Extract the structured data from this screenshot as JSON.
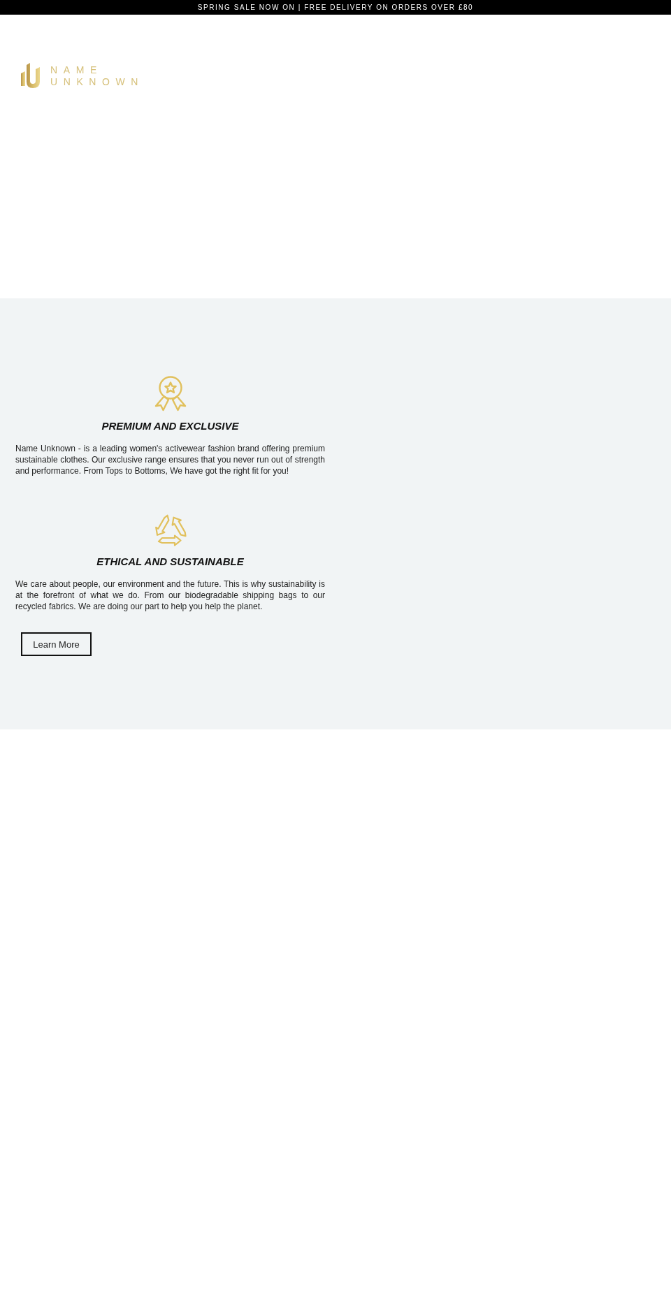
{
  "announcement_bar": {
    "text": "SPRING SALE NOW ON | FREE DELIVERY ON ORDERS OVER £80"
  },
  "header": {
    "logo": {
      "lines": [
        "NAME",
        "UNKNOWN"
      ]
    }
  },
  "features": [
    {
      "kind": "award",
      "title": "PREMIUM AND EXCLUSIVE",
      "body": "Name Unknown - is a leading women's activewear fashion brand offering premium sustainable clothes. Our exclusive range ensures that you never run out of strength and performance. From Tops to Bottoms, We have got the right fit for you!"
    },
    {
      "kind": "recycle",
      "title": "ETHICAL AND SUSTAINABLE",
      "body": "We care about people, our environment and the future. This is why sustainability is at the forefront of what we do. From our biodegradable shipping bags to our recycled fabrics. We are doing our part to help you help the planet."
    }
  ],
  "cta_button": {
    "label": "Learn More"
  }
}
